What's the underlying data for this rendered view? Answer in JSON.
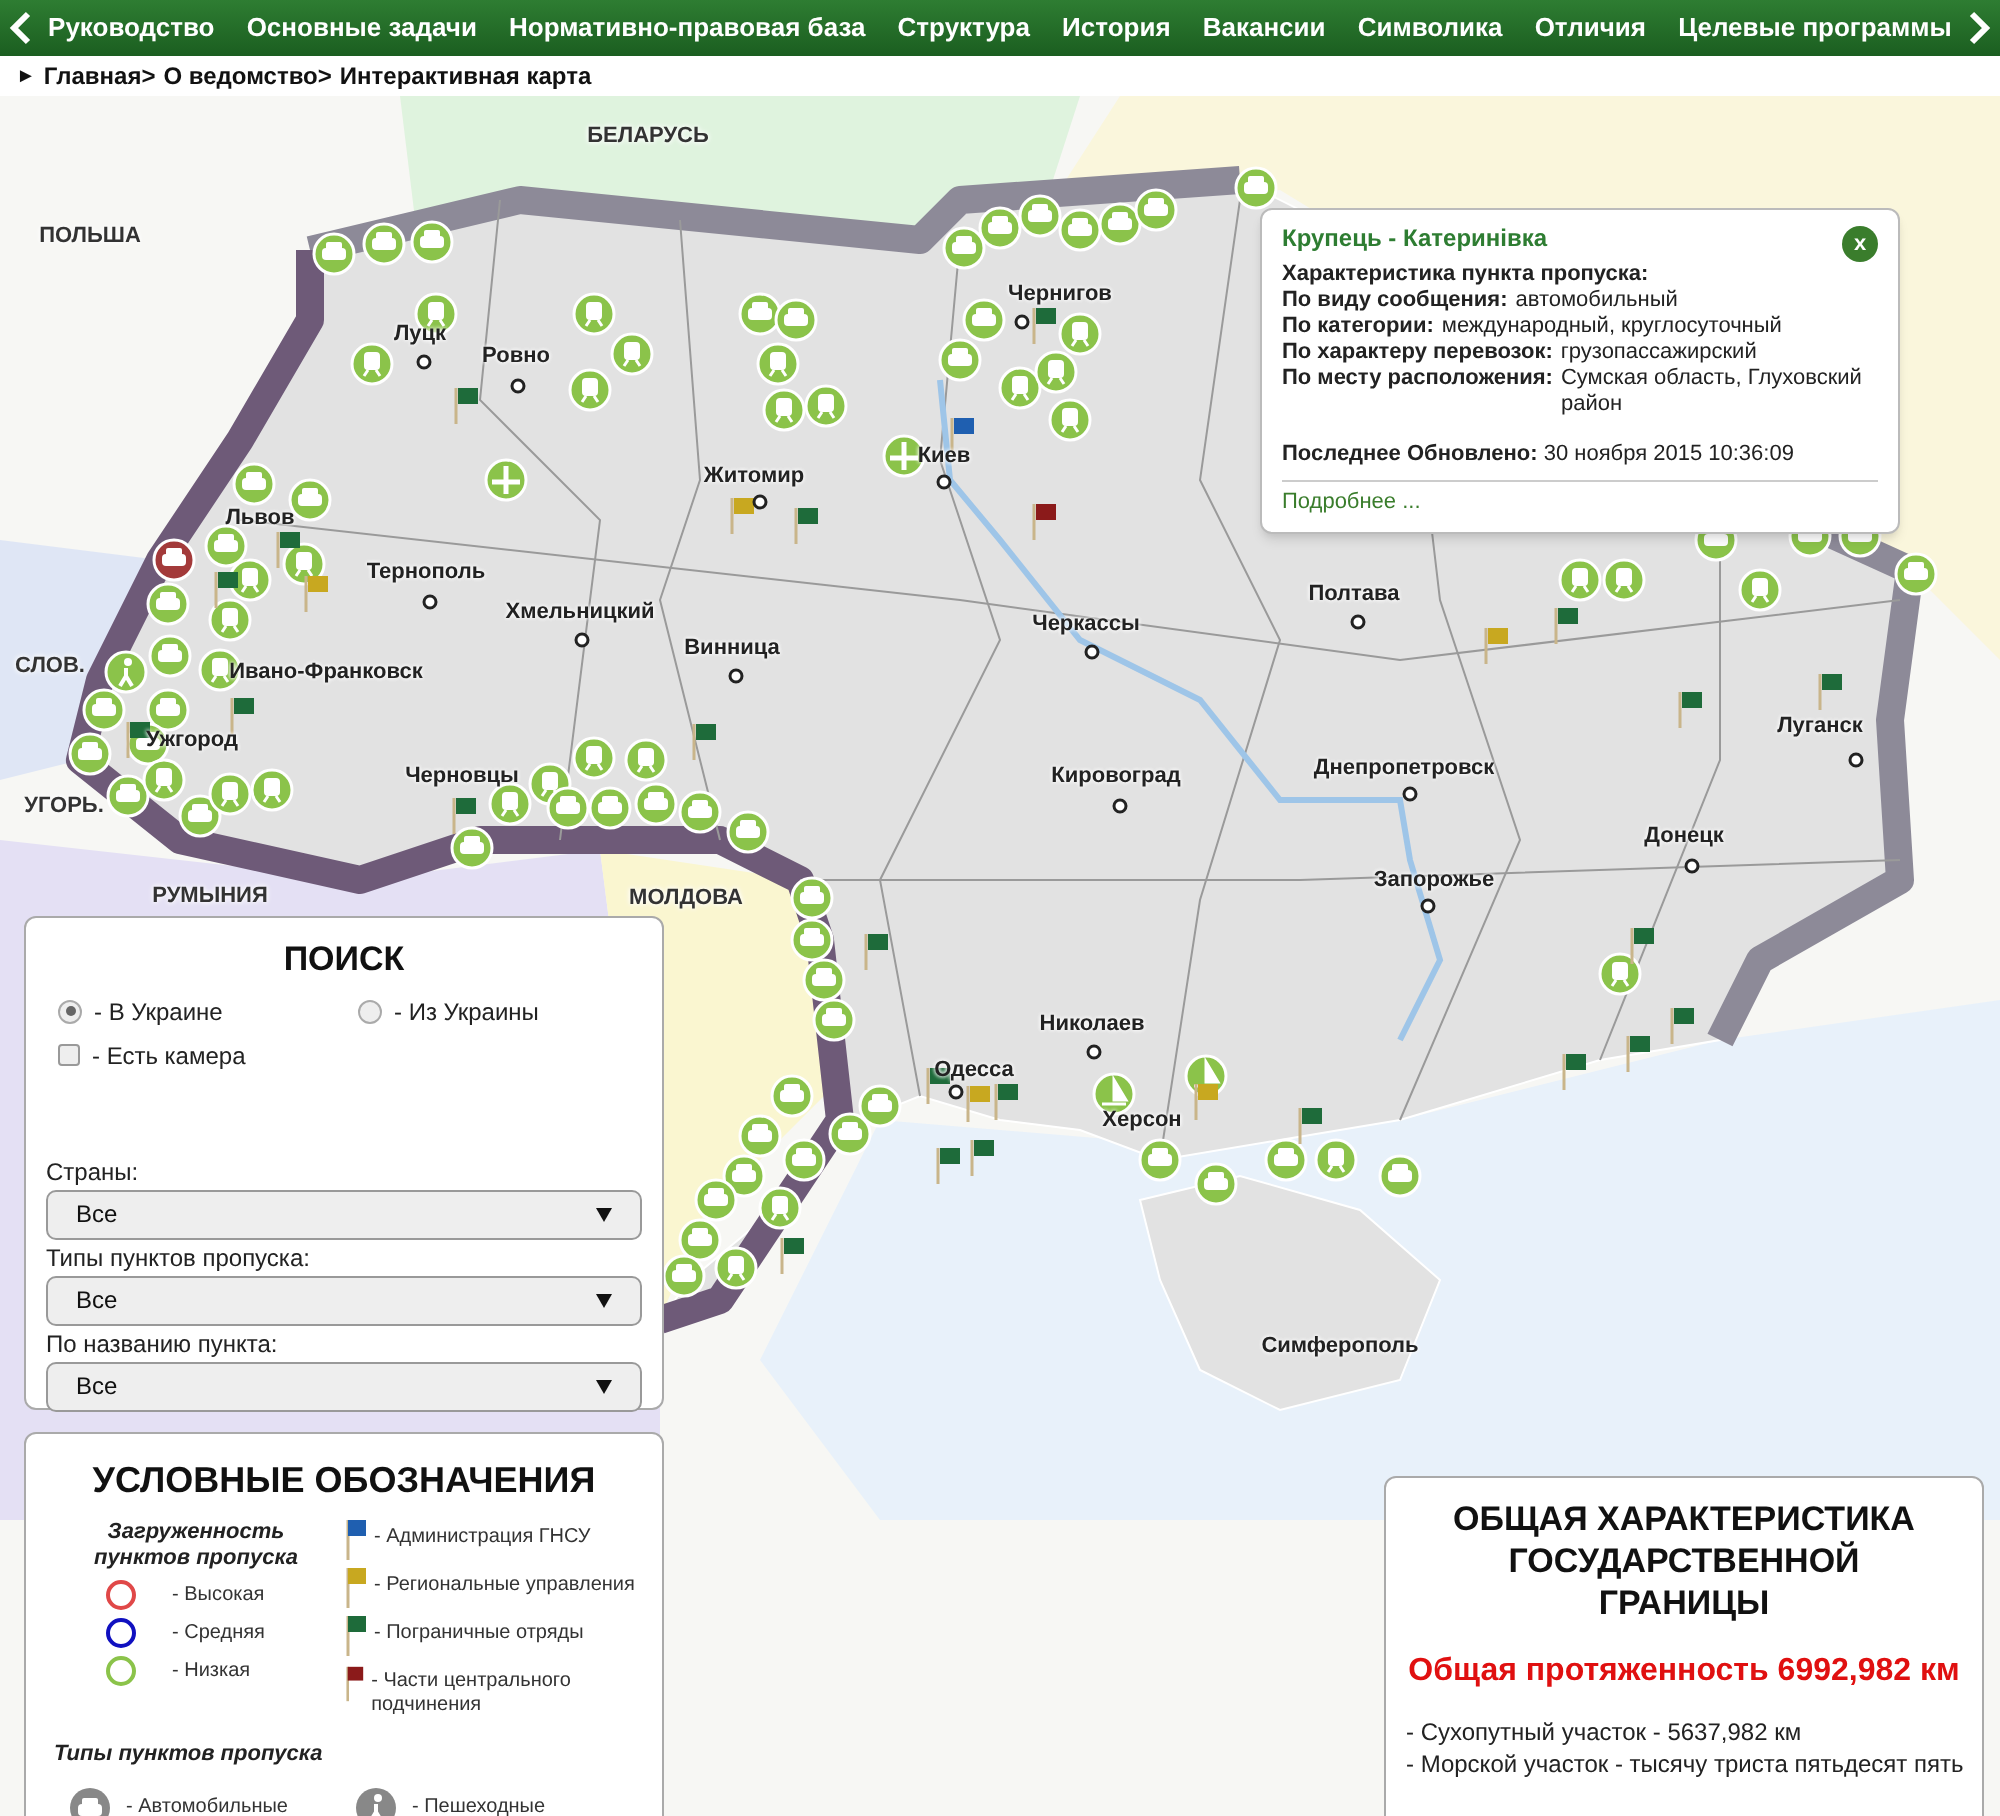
{
  "nav": {
    "items": [
      "Руководство",
      "Основные задачи",
      "Нормативно-правовая база",
      "Структура",
      "История",
      "Вакансии",
      "Символика",
      "Отличия",
      "Целевые программы"
    ]
  },
  "breadcrumb": {
    "marker": "►",
    "items": [
      "Главная>",
      "О ведомство>",
      "Интерактивная карта"
    ]
  },
  "map": {
    "countries": [
      "БЕЛАРУСЬ",
      "ПОЛЬША",
      "СЛОВ.",
      "УГОРЬ.",
      "РУМЫНИЯ",
      "МОЛДОВА"
    ],
    "cities": [
      "Чернигов",
      "Луцк",
      "Ровно",
      "Житомир",
      "Киев",
      "Львов",
      "Тернополь",
      "Хмельницкий",
      "Винница",
      "Полтава",
      "Черкассы",
      "Ивано-Франковск",
      "Ужгород",
      "Черновцы",
      "Кировоград",
      "Днепропетровск",
      "Луганск",
      "Донецк",
      "Запорожье",
      "Николаев",
      "Одесса",
      "Херсон",
      "Симферополь"
    ]
  },
  "popup": {
    "title": "Крупець - Катеринівка",
    "close": "x",
    "heading": "Характеристика пункта пропуска:",
    "fields": [
      {
        "label": "По виду сообщения:",
        "value": "автомобильный"
      },
      {
        "label": "По категории:",
        "value": "международный, круглосуточный"
      },
      {
        "label": "По характеру перевозок:",
        "value": "грузопассажирский"
      },
      {
        "label": "По месту расположения:",
        "value": "Сумская область, Глуховский район"
      }
    ],
    "updated": {
      "label": "Последнее Обновлено:",
      "value": "30 ноября 2015 10:36:09"
    },
    "link": "Подробнее ..."
  },
  "search": {
    "title": "ПОИСК",
    "radios": [
      {
        "label": "- В Украине",
        "selected": true
      },
      {
        "label": "- Из Украины",
        "selected": false
      }
    ],
    "camera": {
      "label": "- Есть камера",
      "checked": false
    },
    "selects": [
      {
        "label": "Страны:",
        "value": "Все"
      },
      {
        "label": "Типы пунктов пропуска:",
        "value": "Все"
      },
      {
        "label": "По названию пункта:",
        "value": "Все"
      }
    ]
  },
  "legend": {
    "title": "УСЛОВНЫЕ ОБОЗНАЧЕНИЯ",
    "load_heading": "Загруженность пунктов пропуска",
    "load_levels": [
      {
        "label": "- Высокая",
        "color": "#e04848"
      },
      {
        "label": "- Средняя",
        "color": "#1010c0"
      },
      {
        "label": "- Низкая",
        "color": "#8bc34a"
      }
    ],
    "flags": [
      {
        "label": "- Администрация ГНСУ",
        "color": "#1f5fb0"
      },
      {
        "label": "- Региональные управления",
        "color": "#c8a820"
      },
      {
        "label": "- Пограничные отряды",
        "color": "#1e6b3a"
      },
      {
        "label": "- Части центрального подчинения",
        "color": "#8b1a1a"
      }
    ],
    "types_heading": "Типы пунктов пропуска",
    "types": [
      {
        "kind": "car",
        "label": "- Автомобильные"
      },
      {
        "kind": "walk",
        "label": "- Пешеходные"
      }
    ]
  },
  "stats": {
    "title": "ОБЩАЯ ХАРАКТЕРИСТИКА ГОСУДАРСТВЕННОЙ ГРАНИЦЫ",
    "total": "Общая протяженность 6992,982 км",
    "lines": [
      "- Сухопутный участок - 5637,982 км",
      "- Морской участок - тысячу триста пятьдесят пять"
    ]
  }
}
